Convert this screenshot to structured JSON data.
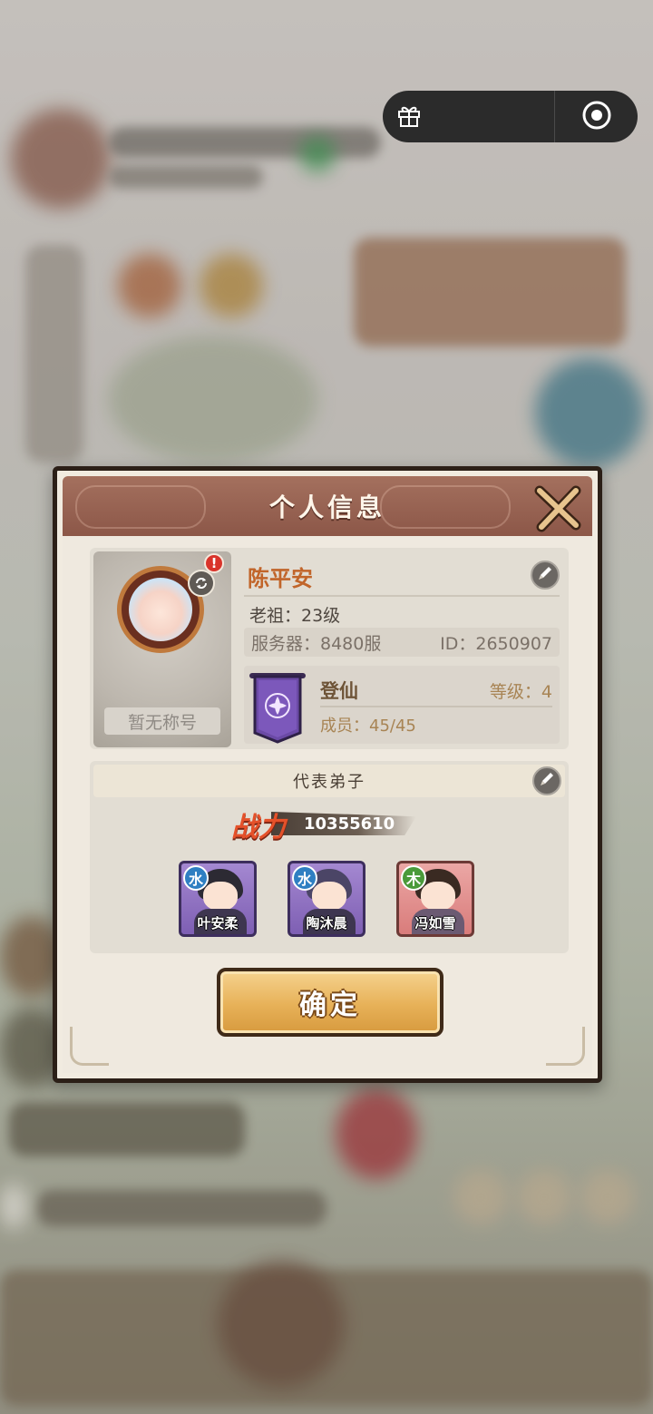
{
  "dialog": {
    "title": "个人信息",
    "player": {
      "name": "陈平安",
      "level_text": "老祖：23级",
      "server_text": "服务器：8480服",
      "id_text": "ID：2650907",
      "title_placeholder": "暂无称号",
      "alert_badge": "!"
    },
    "guild": {
      "name": "登仙",
      "level_text": "等级：4",
      "members_text": "成员：45/45"
    },
    "disciples": {
      "header": "代表弟子",
      "power_label": "战力",
      "power_value": "10355610",
      "cards": [
        {
          "name": "叶安柔",
          "element": "水"
        },
        {
          "name": "陶沐晨",
          "element": "水"
        },
        {
          "name": "冯如雪",
          "element": "木"
        }
      ]
    },
    "confirm_label": "确定"
  },
  "capsule": {
    "icons": [
      "gift-icon",
      "target-icon"
    ]
  },
  "colors": {
    "header_brown": "#8c5748",
    "name_orange": "#c1652a",
    "guild_purple": "#6b4aa6",
    "confirm_gold": "#e7b158",
    "power_red": "#e5512a"
  }
}
